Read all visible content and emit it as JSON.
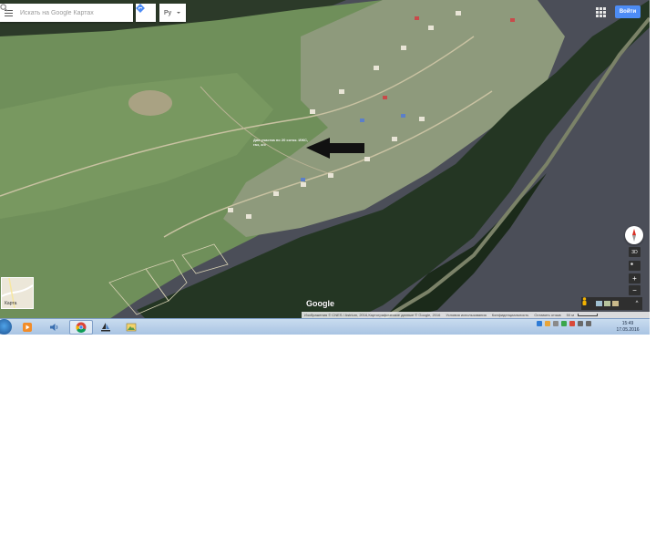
{
  "search": {
    "placeholder": "Искать на Google Картах",
    "value": ""
  },
  "language": {
    "selected": "Ру"
  },
  "header": {
    "signin_label": "Войти"
  },
  "annotation": {
    "text": "Два участка по 20 соток. ИЖС, газ, э/э"
  },
  "map_controls": {
    "tilt_label": "3D",
    "zoom_in_label": "+",
    "zoom_out_label": "−",
    "expand_label": "^"
  },
  "layer_switcher": {
    "label": "Карта"
  },
  "logo": {
    "text": "Google"
  },
  "footer": {
    "imagery": "Изображения © CNES / Astrium, 2016,Картографические данные © Google, 2016",
    "terms": "Условия использования",
    "privacy": "Конфиденциальность",
    "feedback": "Оставить отзыв",
    "scale": "50 м"
  },
  "clock": {
    "time": "15:49",
    "date": "17.05.2016"
  },
  "icons": {
    "menu": "menu-icon",
    "search": "search-icon",
    "directions": "directions-icon",
    "apps": "apps-grid-icon",
    "arrow": "arrow-left-icon",
    "compass": "compass-icon",
    "pegman": "pegman-icon"
  },
  "colors": {
    "signin_button": "#4d8cf5",
    "river": "#4b4e58",
    "field": "#6a8a5b",
    "forest": "#22311f"
  }
}
